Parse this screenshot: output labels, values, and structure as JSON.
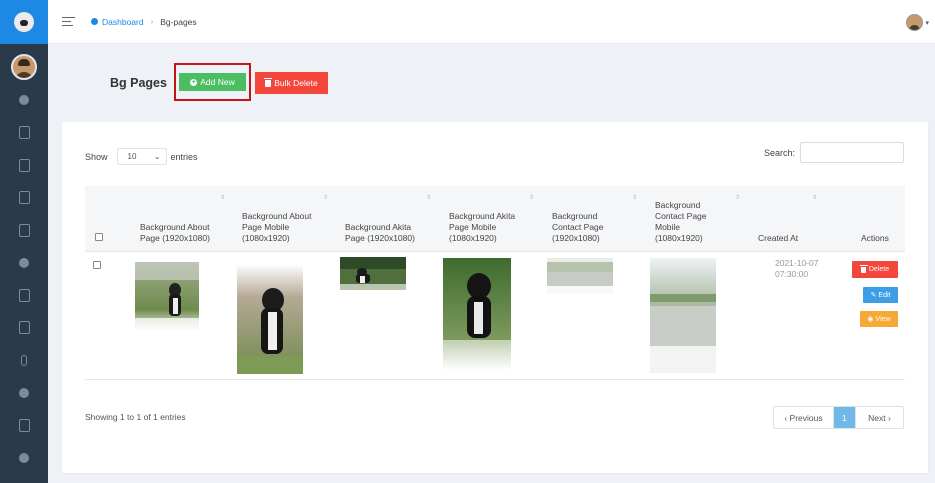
{
  "header": {
    "breadcrumb": {
      "home": "Dashboard",
      "current": "Bg-pages"
    }
  },
  "page": {
    "title": "Bg Pages",
    "add_new_label": "Add New",
    "bulk_delete_label": "Bulk Delete"
  },
  "table_controls": {
    "show_label": "Show",
    "entries_value": "10",
    "entries_label": "entries",
    "search_label": "Search:"
  },
  "table": {
    "columns": [
      "Background About Page (1920x1080)",
      "Background About Page Mobile (1080x1920)",
      "Background Akita Page (1920x1080)",
      "Background Akita Page Mobile (1080x1920)",
      "Background Contact Page (1920x1080)",
      "Background Contact Page Mobile (1080x1920)",
      "Created At",
      "Actions"
    ],
    "rows": [
      {
        "created_at_line1": "2021-10-07",
        "created_at_line2": "07:30:00",
        "actions": {
          "delete": "Delete",
          "edit": "Edit",
          "view": "View"
        }
      }
    ]
  },
  "footer": {
    "info": "Showing 1 to 1 of 1 entries",
    "pagination": {
      "previous": "‹ Previous",
      "current": "1",
      "next": "Next ›"
    }
  },
  "colors": {
    "sidebar": "#2b3a4a",
    "brand": "#1e88e5",
    "add_button": "#4cbe62",
    "delete_button": "#f4473b",
    "edit_button": "#3d9ee8",
    "view_button": "#f7a936",
    "highlight_box": "#c0151b"
  }
}
